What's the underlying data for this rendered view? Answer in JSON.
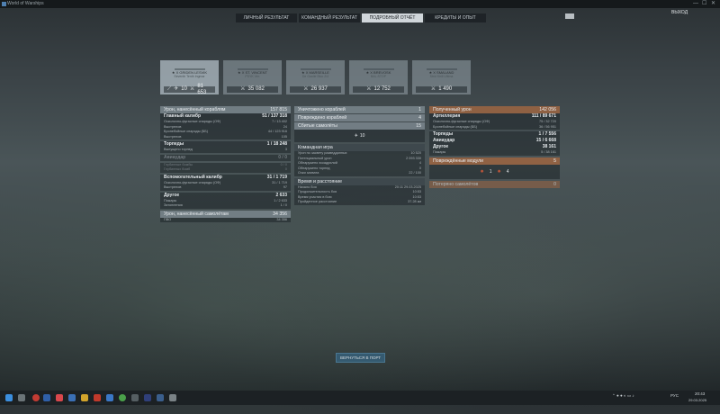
{
  "window": {
    "title": "World of Warships",
    "controls": [
      "—",
      "☐",
      "✕"
    ]
  },
  "tabs": [
    {
      "label": "ЛИЧНЫЙ РЕЗУЛЬТАТ",
      "active": false
    },
    {
      "label": "КОМАНДНЫЙ РЕЗУЛЬТАТ",
      "active": false
    },
    {
      "label": "ПОДРОБНЫЙ ОТЧЁТ",
      "active": true
    },
    {
      "label": "КРЕДИТЫ И ОПЫТ",
      "active": false
    }
  ],
  "exit_label": "ВЫХОД",
  "ships": [
    {
      "name": "★ X GRIDEN LESVIK",
      "sub": "Seventh Tenth Ingmar",
      "stat1": "10",
      "stat2": "81 653",
      "selected": true
    },
    {
      "name": "★ X ST. VINCENT",
      "sub": "PSYK Ver.",
      "stat1": "",
      "stat2": "35 082",
      "selected": false
    },
    {
      "name": "★ X MARSEILLE",
      "sub": "De Gaulle Bloc 2/4",
      "stat1": "",
      "stat2": "26 937",
      "selected": false
    },
    {
      "name": "★ X BREVOSK",
      "sub": "BAL.STOP",
      "stat1": "",
      "stat2": "12 752",
      "selected": false
    },
    {
      "name": "★ X SMALAND",
      "sub": "Strid Kirill Ultima",
      "stat1": "",
      "stat2": "1 490",
      "selected": false
    }
  ],
  "damage_ships": {
    "header": {
      "label": "Урон, нанесённый кораблям",
      "value": "157 815"
    },
    "main_caliber": {
      "label": "Главный калибр",
      "value": "51 / 137 318"
    },
    "he_shells": {
      "label": "Осколочно-фугасные снаряды (ОФ)",
      "value": "7 / 13 402"
    },
    "he_hits": {
      "label": "Выстрелов",
      "value": "24"
    },
    "ap_shells": {
      "label": "Бронебойные снаряды (ББ)",
      "value": "44 / 123 916"
    },
    "ap_hits": {
      "label": "Выстрелов",
      "value": "105"
    },
    "torpedoes": {
      "label": "Торпеды",
      "value": "1 / 18 248"
    },
    "torp_fired": {
      "label": "Выпущено торпед",
      "value": "3"
    },
    "aviation": {
      "label": "Авиаудар",
      "value": "0 / 0"
    },
    "bombs1": {
      "label": "Глубинные бомбы",
      "value": "0 / 0"
    },
    "bombs2": {
      "label": "Глубинных бомб",
      "value": "0"
    },
    "secondary": {
      "label": "Вспомогательный калибр",
      "value": "31 / 1 719"
    },
    "sec_he": {
      "label": "Осколочно-фугасные снаряды (ОФ)",
      "value": "31 / 1 719"
    },
    "sec_hits": {
      "label": "Выстрелов",
      "value": "97"
    },
    "other": {
      "label": "Другое",
      "value": "2 633"
    },
    "fires": {
      "label": "Пожары",
      "value": "1 / 2 633"
    },
    "flooding": {
      "label": "Затопления",
      "value": "1 / 0"
    }
  },
  "damage_planes": {
    "header": {
      "label": "Урон, нанесённый самолётам",
      "value": "34 356"
    },
    "aa": {
      "label": "ПВО",
      "value": "34 356"
    }
  },
  "middle": {
    "destroyed": {
      "label": "Уничтожено кораблей",
      "value": "1"
    },
    "damaged": {
      "label": "Повреждено кораблей",
      "value": "4"
    },
    "planes": {
      "label": "Сбитые самолёты",
      "value": "15"
    },
    "ribbon_value": "10",
    "team_header": "Командная игра",
    "team_rows": [
      {
        "label": "Урон по засвету разведданных",
        "value": "10 520"
      },
      {
        "label": "Потенциальный урон",
        "value": "2 093 330"
      },
      {
        "label": "Обнаружено эскадрилий",
        "value": "4"
      },
      {
        "label": "Обнаружено торпед",
        "value": "0"
      },
      {
        "label": "Очки захвата",
        "value": "22 / 100"
      }
    ],
    "time_header": "Время и расстояние",
    "time_rows": [
      {
        "label": "Начало боя",
        "value": "20:11  29.03.2025"
      },
      {
        "label": "Продолжительность боя",
        "value": "10:53"
      },
      {
        "label": "Время участия в бою",
        "value": "10:53"
      },
      {
        "label": "Пройденное расстояние",
        "value": "37.28 км"
      }
    ]
  },
  "received": {
    "header": {
      "label": "Полученный урон",
      "value": "142 056"
    },
    "artillery": {
      "label": "Артиллерия",
      "value": "111 / 89 671"
    },
    "he": {
      "label": "Осколочно-фугасные снаряды (ОФ)",
      "value": "75 / 32 720"
    },
    "ap": {
      "label": "Бронебойные снаряды (ББ)",
      "value": "36 / 56 951"
    },
    "torpedoes": {
      "label": "Торпеды",
      "value": "1 / 7 556"
    },
    "aviation": {
      "label": "Авиаудар",
      "value": "15 / 6 668"
    },
    "other": {
      "label": "Другое",
      "value": "38 161"
    },
    "fires": {
      "label": "Пожары",
      "value": "5 / 38 161"
    },
    "modules": {
      "label": "Повреждённые модули",
      "value": "5"
    },
    "module_icons": [
      {
        "icon": "module-damage-icon",
        "count": "1"
      },
      {
        "icon": "module-damage-icon",
        "count": "4"
      }
    ],
    "lost_planes": {
      "label": "Потеряно самолётов",
      "value": "0"
    }
  },
  "return_button": "ВЕРНУТЬСЯ В ПОРТ",
  "taskbar": {
    "lang": "РУС",
    "time": "20:43",
    "date": "29.03.2025"
  },
  "colors": {
    "orange": "#98643f",
    "grey": "#7a868d",
    "active_tab": "#d0d6da"
  }
}
